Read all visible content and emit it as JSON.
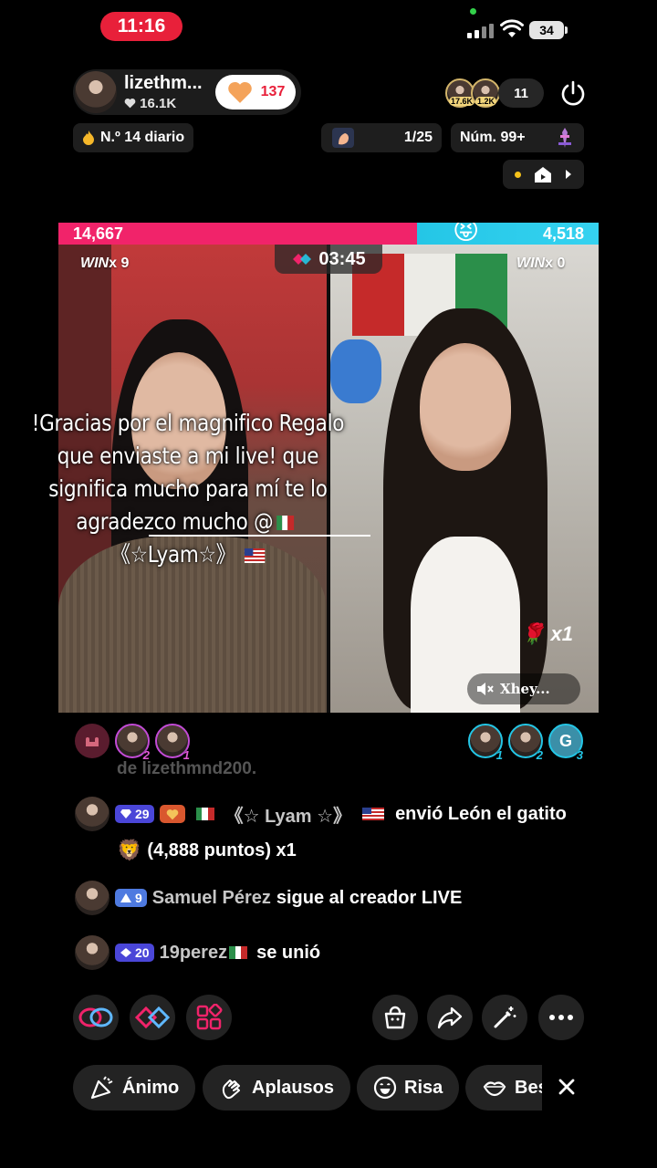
{
  "status_bar": {
    "time": "11:16",
    "battery": "34"
  },
  "host": {
    "name": "lizethm...",
    "likes": "16.1K",
    "follow_count": "137",
    "viewer_badges": [
      "17.6K",
      "1.2K"
    ],
    "viewer_count": "11"
  },
  "ranks": {
    "daily": "N.º 14 diario",
    "gift_goal": "1/25",
    "number": "Núm. 99+"
  },
  "battle": {
    "score_left": "14,667",
    "score_right": "4,518",
    "win_left_label": "WIN",
    "win_left_count": "x 9",
    "win_right_label": "WIN",
    "win_right_count": "x 0",
    "timer": "03:45",
    "rose_count": "x1",
    "guest_name": "Xhey..."
  },
  "overlay_message": "!Gracias por el magnifico Regalo que enviaste a mi live! que significa mucho para mí te lo agradezco mucho @",
  "overlay_mention": "《☆Lyam☆》",
  "supporters_left": [
    {
      "rank": "2"
    },
    {
      "rank": "1"
    }
  ],
  "supporters_right": [
    {
      "rank": "1"
    },
    {
      "rank": "2"
    },
    {
      "initial": "G",
      "rank": "3"
    }
  ],
  "chat": {
    "faded_text": "de lizethmnd200.",
    "messages": [
      {
        "level": "29",
        "user": "《☆ Lyam ☆》",
        "text": "envió León el gatito",
        "text2": "(4,888 puntos) x1"
      },
      {
        "level": "9",
        "user": "Samuel Pérez",
        "text": "sigue al creador LIVE"
      },
      {
        "level": "20",
        "user": "19perez",
        "text": "se unió"
      }
    ]
  },
  "reactions": [
    "Ánimo",
    "Aplausos",
    "Risa",
    "Bes"
  ],
  "colors": {
    "live_red": "#e8203a",
    "score_pink": "#f1236a",
    "score_cyan": "#24c6e6",
    "level_purple": "#4a46d8"
  },
  "icons": [
    "heart-icon",
    "power-icon",
    "fire-icon",
    "gift-icon",
    "trophy-icon",
    "play-icon",
    "rose-icon",
    "mute-icon",
    "link-icon",
    "versus-icon",
    "apps-icon",
    "shop-icon",
    "share-icon",
    "magic-wand-icon",
    "more-icon",
    "close-icon"
  ]
}
